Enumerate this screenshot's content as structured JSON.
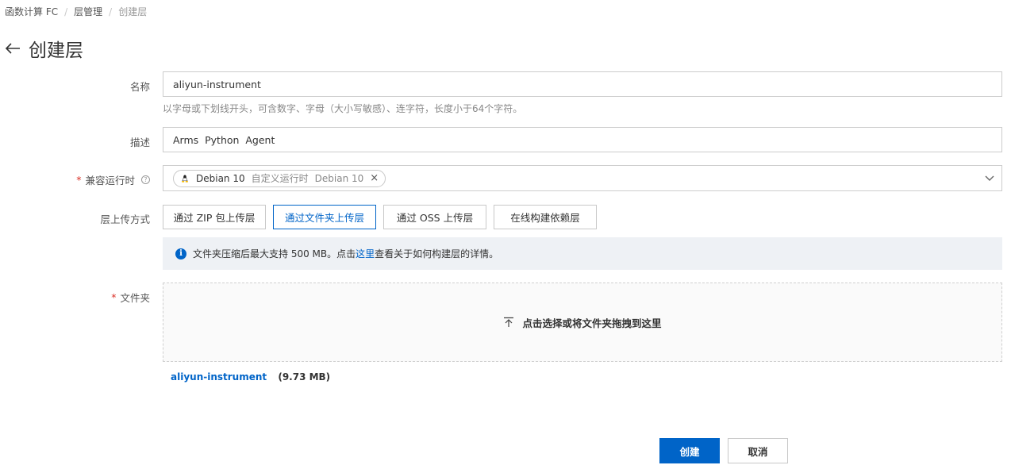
{
  "breadcrumb": {
    "items": [
      "函数计算 FC",
      "层管理"
    ],
    "current": "创建层",
    "separator": "/"
  },
  "page": {
    "title": "创建层",
    "back_icon": "arrow-left-icon"
  },
  "form": {
    "name": {
      "label": "名称",
      "value": "aliyun-instrument",
      "hint": "以字母或下划线开头，可含数字、字母（大小写敏感）、连字符，长度小于64个字符。"
    },
    "description": {
      "label": "描述",
      "value": "Arms  Python  Agent"
    },
    "runtime": {
      "label": "兼容运行时",
      "required_mark": "*",
      "help_icon": "question-circle-icon",
      "tag": {
        "name": "Debian 10",
        "desc": "自定义运行时",
        "desc2": "Debian 10",
        "close": "×",
        "icon": "linux-tux-icon"
      },
      "dropdown_icon": "chevron-down-icon"
    },
    "upload_method": {
      "label": "层上传方式",
      "options": [
        "通过 ZIP 包上传层",
        "通过文件夹上传层",
        "通过 OSS 上传层",
        "在线构建依赖层"
      ],
      "selected_index": 1
    },
    "notice": {
      "icon": "info-icon",
      "before": "文件夹压缩后最大支持 500 MB。点击",
      "link": "这里",
      "after": "查看关于如何构建层的详情。"
    },
    "folder": {
      "label": "文件夹",
      "required_mark": "*",
      "dropzone_text": "点击选择或将文件夹拖拽到这里",
      "upload_icon": "upload-icon",
      "file_name": "aliyun-instrument",
      "file_size": "(9.73 MB)"
    }
  },
  "actions": {
    "create_label": "创建",
    "cancel_label": "取消"
  },
  "colors": {
    "primary": "#0064c8",
    "required": "#d93026",
    "notice_bg": "#eef1f5"
  }
}
